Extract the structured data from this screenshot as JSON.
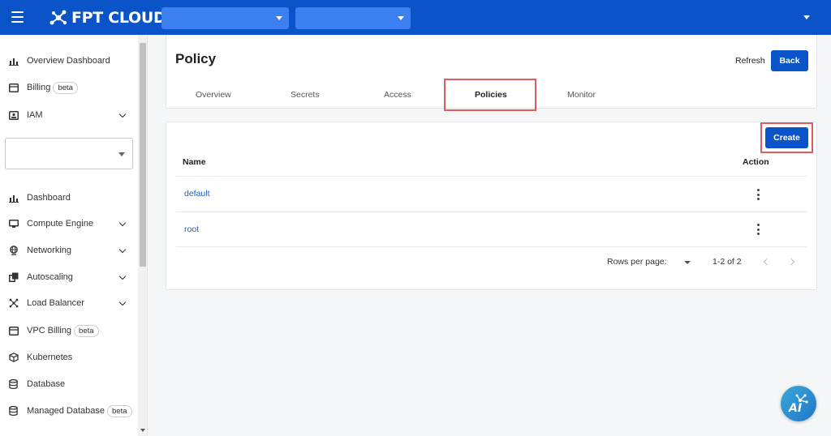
{
  "brand": {
    "logo_text": "FPT CLOUD"
  },
  "topbar": {
    "select_1_value": "",
    "select_2_value": ""
  },
  "sidebar": {
    "items": [
      {
        "label": "Overview Dashboard",
        "icon": "bar-chart-icon"
      },
      {
        "label": "Billing",
        "icon": "billing-icon",
        "badge": "beta"
      },
      {
        "label": "IAM",
        "icon": "iam-icon"
      },
      {
        "label": "Dashboard",
        "icon": "bar-chart-icon"
      },
      {
        "label": "Compute Engine",
        "icon": "monitor-icon"
      },
      {
        "label": "Networking",
        "icon": "globe-icon"
      },
      {
        "label": "Autoscaling",
        "icon": "autoscaling-icon"
      },
      {
        "label": "Load Balancer",
        "icon": "load-balancer-icon"
      },
      {
        "label": "VPC Billing",
        "icon": "billing-icon",
        "badge": "beta"
      },
      {
        "label": "Kubernetes",
        "icon": "cube-icon"
      },
      {
        "label": "Database",
        "icon": "database-icon"
      },
      {
        "label": "Managed Database",
        "icon": "database-icon",
        "badge": "beta"
      }
    ],
    "project_select_value": ""
  },
  "page": {
    "title": "Policy",
    "refresh_label": "Refresh",
    "back_label": "Back",
    "tabs": [
      {
        "label": "Overview"
      },
      {
        "label": "Secrets"
      },
      {
        "label": "Access"
      },
      {
        "label": "Policies",
        "active": true
      },
      {
        "label": "Monitor"
      }
    ]
  },
  "table": {
    "create_label": "Create",
    "columns": [
      "Name",
      "Action"
    ],
    "rows": [
      {
        "name": "default"
      },
      {
        "name": "root"
      }
    ],
    "footer": {
      "rows_per_page_label": "Rows per page:",
      "range_text": "1-2 of 2"
    }
  },
  "ai_assistant": {
    "label": "AI"
  },
  "colors": {
    "brand_blue": "#0a53c8",
    "highlight_red": "#e25b5b",
    "link_blue": "#1a5fc9"
  }
}
